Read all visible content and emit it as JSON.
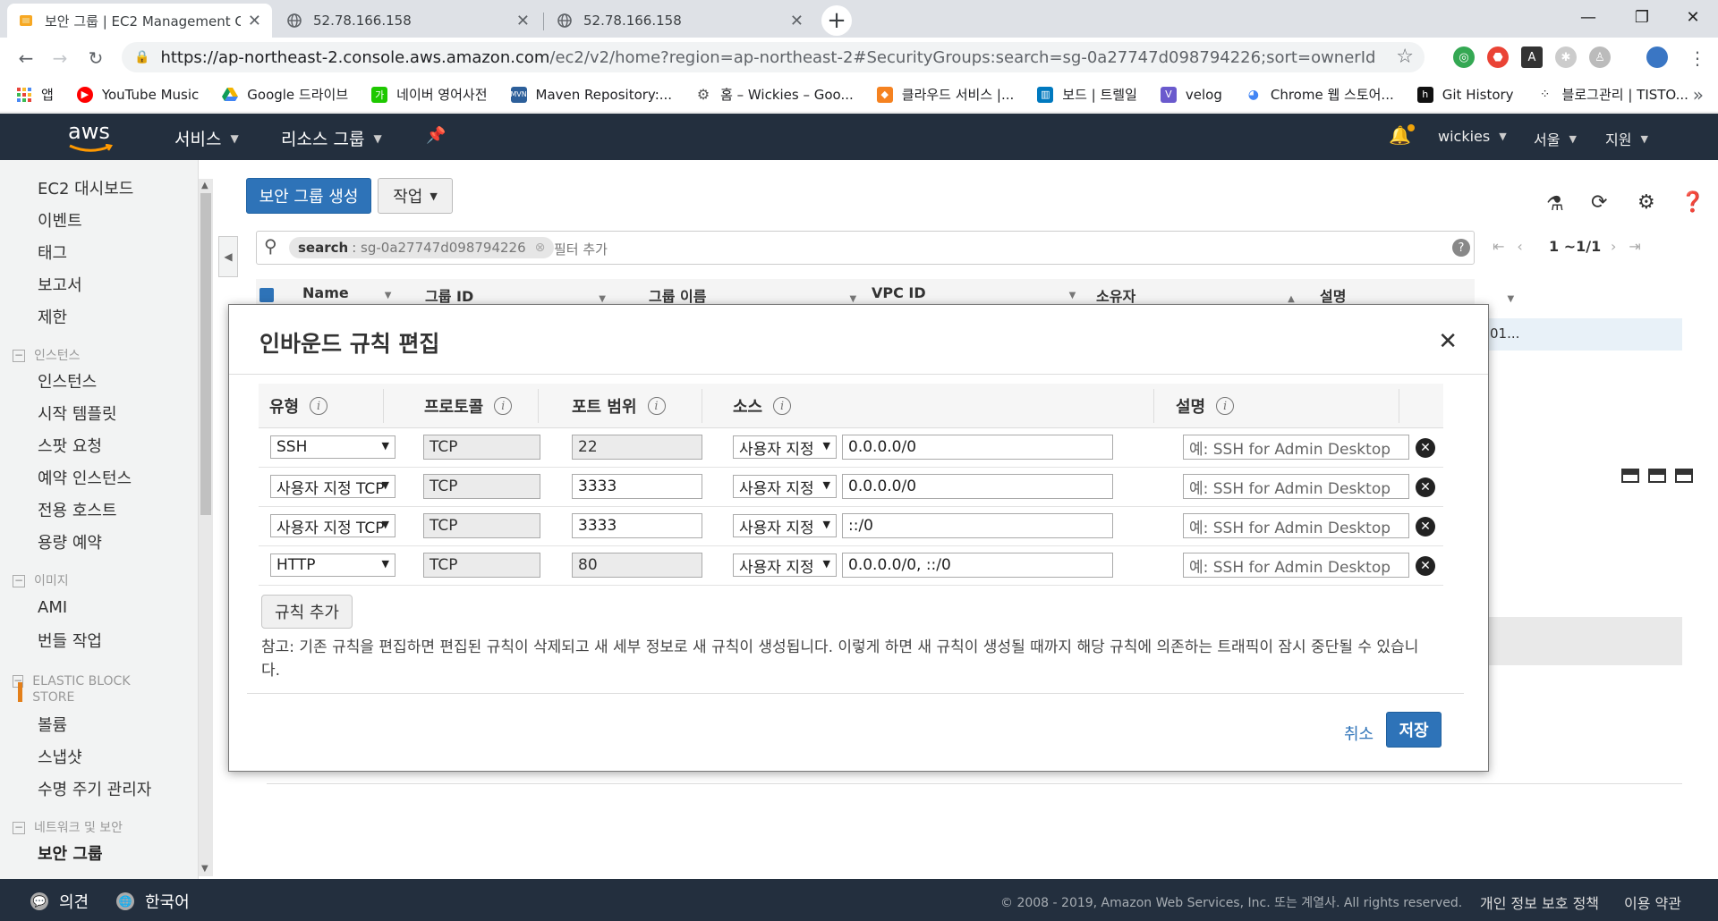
{
  "browser": {
    "tabs": [
      {
        "title": "보안 그룹 | EC2 Management C",
        "active": true
      },
      {
        "title": "52.78.166.158",
        "active": false
      },
      {
        "title": "52.78.166.158",
        "active": false
      }
    ],
    "url_host": "https://ap-northeast-2.console.aws.amazon.com",
    "url_rest": "/ec2/v2/home?region=ap-northeast-2#SecurityGroups:search=sg-0a27747d098794226;sort=ownerId",
    "bookmarks": [
      {
        "label": "앱",
        "icon": "apps-grid-icon",
        "color": "#e8453c"
      },
      {
        "label": "YouTube Music",
        "icon": "youtube-music-icon",
        "color": "#ff0000"
      },
      {
        "label": "Google 드라이브",
        "icon": "google-drive-icon",
        "color": "#f4b400"
      },
      {
        "label": "네이버 영어사전",
        "icon": "naver-dict-icon",
        "color": "#1ec800"
      },
      {
        "label": "Maven Repository:...",
        "icon": "maven-icon",
        "color": "#2d5f9a"
      },
      {
        "label": "홈 – Wickies – Goo...",
        "icon": "wickies-icon",
        "color": "#555555"
      },
      {
        "label": "클라우드 서비스 |...",
        "icon": "cloud-service-icon",
        "color": "#f58220"
      },
      {
        "label": "보드 | 트렐일",
        "icon": "trello-icon",
        "color": "#0079bf"
      },
      {
        "label": "velog",
        "icon": "velog-icon",
        "color": "#6a5acd"
      },
      {
        "label": "Chrome 웹 스토어...",
        "icon": "chrome-store-icon",
        "color": "#4285f4"
      },
      {
        "label": "Git History",
        "icon": "git-history-icon",
        "color": "#111111"
      },
      {
        "label": "블로그관리 | TISTO...",
        "icon": "tistory-icon",
        "color": "#333333"
      }
    ]
  },
  "aws": {
    "logo": "aws",
    "nav": {
      "services": "서비스",
      "resource_groups": "리소스 그룹"
    },
    "user": "wickies",
    "region": "서울",
    "support": "지원"
  },
  "sidebar": {
    "items_top": [
      "EC2 대시보드",
      "이벤트",
      "태그",
      "보고서",
      "제한"
    ],
    "section_instances": "인스턴스",
    "items_instances": [
      "인스턴스",
      "시작 템플릿",
      "스팟 요청",
      "예약 인스턴스",
      "전용 호스트",
      "용량 예약"
    ],
    "section_images": "이미지",
    "items_images": [
      "AMI",
      "번들 작업"
    ],
    "section_ebs": "ELASTIC BLOCK STORE",
    "items_ebs": [
      "볼륨",
      "스냅샷",
      "수명 주기 관리자"
    ],
    "section_network": "네트워크 및 보안",
    "items_network": [
      "보안 그룹"
    ]
  },
  "main": {
    "create_sg_button": "보안 그룹 생성",
    "actions_button": "작업",
    "search_token_key": "search",
    "search_token_value": ": sg-0a27747d098794226",
    "add_filter_placeholder": "필터 추가",
    "pagination": "1 ~1/1",
    "columns": [
      "Name",
      "그룹 ID",
      "그룹 이름",
      "VPC ID",
      "소유자",
      "설명"
    ],
    "row_partial": "01..."
  },
  "modal": {
    "title": "인바운드 규칙 편집",
    "columns": {
      "type": "유형",
      "protocol": "프로토콜",
      "port_range": "포트 범위",
      "source": "소스",
      "description": "설명"
    },
    "rules": [
      {
        "type": "SSH",
        "protocol": "TCP",
        "port": "22",
        "port_readonly": true,
        "source_type": "사용자 지정",
        "source": "0.0.0.0/0",
        "description_placeholder": "예: SSH for Admin Desktop"
      },
      {
        "type": "사용자 지정 TCP",
        "protocol": "TCP",
        "port": "3333",
        "port_readonly": false,
        "source_type": "사용자 지정",
        "source": "0.0.0.0/0",
        "description_placeholder": "예: SSH for Admin Desktop"
      },
      {
        "type": "사용자 지정 TCP",
        "protocol": "TCP",
        "port": "3333",
        "port_readonly": false,
        "source_type": "사용자 지정",
        "source": "::/0",
        "description_placeholder": "예: SSH for Admin Desktop"
      },
      {
        "type": "HTTP",
        "protocol": "TCP",
        "port": "80",
        "port_readonly": true,
        "source_type": "사용자 지정",
        "source": "0.0.0.0/0, ::/0",
        "description_placeholder": "예: SSH for Admin Desktop"
      }
    ],
    "add_rule_button": "규칙 추가",
    "note": "참고: 기존 규칙을 편집하면 편집된 규칙이 삭제되고 새 세부 정보로 새 규칙이 생성됩니다. 이렇게 하면 새 규칙이 생성될 때까지 해당 규칙에 의존하는 트래픽이 잠시 중단될 수 있습니다.",
    "cancel": "취소",
    "save": "저장"
  },
  "footer": {
    "feedback": "의견",
    "language": "한국어",
    "copyright": "© 2008 - 2019, Amazon Web Services, Inc. 또는 계열사. All rights reserved.",
    "privacy": "개인 정보 보호 정책",
    "terms": "이용 약관"
  },
  "colors": {
    "aws_nav_bg": "#232f3e",
    "primary_blue": "#2e73b8",
    "active_orange": "#e37f1a"
  }
}
